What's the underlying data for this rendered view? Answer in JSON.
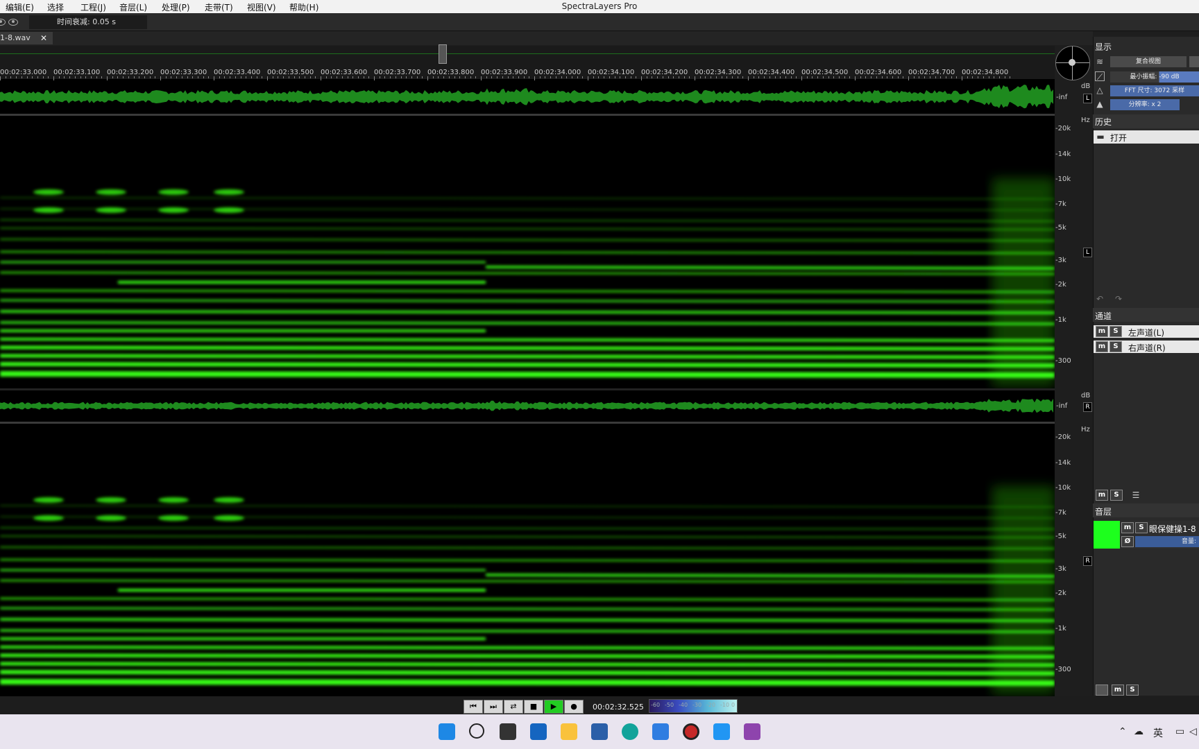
{
  "menu": {
    "items": [
      "编辑(E)",
      "选择",
      "工程(J)",
      "音层(L)",
      "处理(P)",
      "走带(T)",
      "视图(V)",
      "帮助(H)"
    ],
    "app_title": "SpectraLayers Pro"
  },
  "toolbar": {
    "decay_label": "时间衰减: 0.05 s"
  },
  "file_tab": {
    "name": "1-8.wav",
    "close": "✕"
  },
  "ruler": {
    "ticks": [
      "00:02:33.000",
      "00:02:33.100",
      "00:02:33.200",
      "00:02:33.300",
      "00:02:33.400",
      "00:02:33.500",
      "00:02:33.600",
      "00:02:33.700",
      "00:02:33.800",
      "00:02:33.900",
      "00:02:34.000",
      "00:02:34.100",
      "00:02:34.200",
      "00:02:34.300",
      "00:02:34.400",
      "00:02:34.500",
      "00:02:34.600",
      "00:02:34.700",
      "00:02:34.800"
    ]
  },
  "axis": {
    "db_unit": "dB",
    "hz_unit": "Hz",
    "inf_label": "-inf",
    "freq_labels": [
      "20k",
      "14k",
      "10k",
      "7k",
      "5k",
      "3k",
      "2k",
      "1k",
      "300"
    ],
    "left_channel": "L",
    "right_channel": "R"
  },
  "display_panel": {
    "title": "显示",
    "view_button": "复合视图",
    "min_amp": "最小振幅: -90 dB",
    "fft": "FFT 尺寸: 3072 采样",
    "resolution": "分辨率: x 2"
  },
  "history_panel": {
    "title": "历史",
    "items": [
      {
        "label": "打开",
        "icon": "folder-icon"
      }
    ]
  },
  "channels_panel": {
    "title": "通道",
    "items": [
      {
        "label": "左声道(L)"
      },
      {
        "label": "右声道(R)"
      }
    ]
  },
  "layers_panel": {
    "title": "音层",
    "layer_name": "眼保健操1-8",
    "volume_label": "音量:",
    "phase_symbol": "Ø"
  },
  "mute_solo": {
    "m": "m",
    "s": "S"
  },
  "transport": {
    "timecode": "00:02:32.525",
    "meter_labels": [
      "-60",
      "-50",
      "-40",
      "-30",
      "-20",
      "-10",
      "0"
    ]
  },
  "taskbar": {
    "icons": [
      "windows-start-icon",
      "search-icon",
      "task-view-icon",
      "widgets-icon",
      "file-explorer-icon",
      "store-icon",
      "edge-icon",
      "mail-icon",
      "record-icon",
      "phone-icon",
      "spectralayers-icon"
    ],
    "ime": "英"
  },
  "colors": {
    "spectrogram": "#39ff14",
    "waveform": "#1e8a1e",
    "play_button": "#22cc22"
  }
}
